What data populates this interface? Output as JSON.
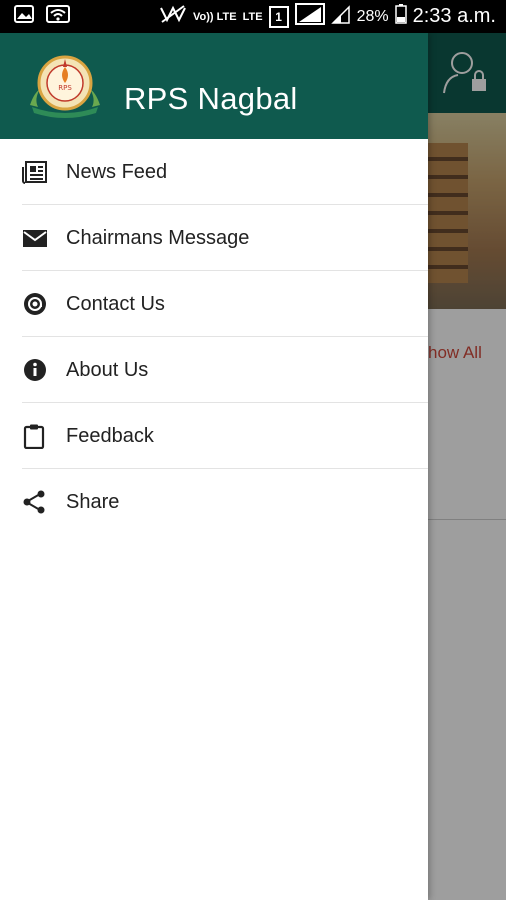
{
  "status_bar": {
    "battery_percent": "28%",
    "time": "2:33 a.m.",
    "volte": "Vo)) LTE",
    "lte": "LTE",
    "sim_slot": "1"
  },
  "drawer": {
    "title": "RPS Nagbal",
    "menu": [
      {
        "label": "News Feed",
        "icon": "newspaper-icon"
      },
      {
        "label": "Chairmans Message",
        "icon": "mail-icon"
      },
      {
        "label": "Contact Us",
        "icon": "at-sign-icon"
      },
      {
        "label": "About Us",
        "icon": "info-icon"
      },
      {
        "label": "Feedback",
        "icon": "clipboard-icon"
      },
      {
        "label": "Share",
        "icon": "share-icon"
      }
    ]
  },
  "background": {
    "show_all_label": "how All"
  },
  "colors": {
    "primary": "#0f5a4e",
    "accent_text": "#d14a3c"
  }
}
